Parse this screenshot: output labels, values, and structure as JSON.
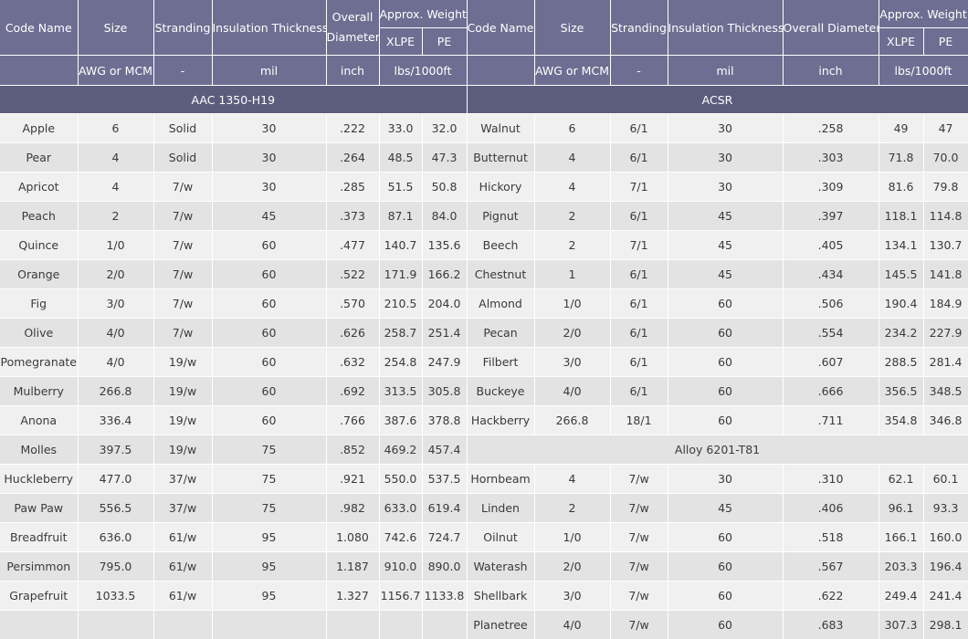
{
  "headers": {
    "code_name": "Code Name",
    "size": "Size",
    "stranding": "Stranding",
    "insulation_thickness": "Insulation Thickness",
    "overall_diameter_left": "Overall Diameter",
    "overall_diameter_right": "Overall Diameter",
    "approx_weight": "Approx. Weight",
    "xlpe": "XLPE",
    "pe": "PE"
  },
  "units": {
    "size": "AWG or MCM",
    "stranding": "-",
    "insulation": "mil",
    "diameter": "inch",
    "weight": "lbs/1000ft"
  },
  "sections": {
    "left_title": "AAC 1350-H19",
    "right_title": "ACSR",
    "right_subsection": "Alloy 6201-T81"
  },
  "left_rows": [
    {
      "code": "Apple",
      "size": "6",
      "strand": "Solid",
      "ins": "30",
      "dia": ".222",
      "xlpe": "33.0",
      "pe": "32.0"
    },
    {
      "code": "Pear",
      "size": "4",
      "strand": "Solid",
      "ins": "30",
      "dia": ".264",
      "xlpe": "48.5",
      "pe": "47.3"
    },
    {
      "code": "Apricot",
      "size": "4",
      "strand": "7/w",
      "ins": "30",
      "dia": ".285",
      "xlpe": "51.5",
      "pe": "50.8"
    },
    {
      "code": "Peach",
      "size": "2",
      "strand": "7/w",
      "ins": "45",
      "dia": ".373",
      "xlpe": "87.1",
      "pe": "84.0"
    },
    {
      "code": "Quince",
      "size": "1/0",
      "strand": "7/w",
      "ins": "60",
      "dia": ".477",
      "xlpe": "140.7",
      "pe": "135.6"
    },
    {
      "code": "Orange",
      "size": "2/0",
      "strand": "7/w",
      "ins": "60",
      "dia": ".522",
      "xlpe": "171.9",
      "pe": "166.2"
    },
    {
      "code": "Fig",
      "size": "3/0",
      "strand": "7/w",
      "ins": "60",
      "dia": ".570",
      "xlpe": "210.5",
      "pe": "204.0"
    },
    {
      "code": "Olive",
      "size": "4/0",
      "strand": "7/w",
      "ins": "60",
      "dia": ".626",
      "xlpe": "258.7",
      "pe": "251.4"
    },
    {
      "code": "Pomegranate",
      "size": "4/0",
      "strand": "19/w",
      "ins": "60",
      "dia": ".632",
      "xlpe": "254.8",
      "pe": "247.9"
    },
    {
      "code": "Mulberry",
      "size": "266.8",
      "strand": "19/w",
      "ins": "60",
      "dia": ".692",
      "xlpe": "313.5",
      "pe": "305.8"
    },
    {
      "code": "Anona",
      "size": "336.4",
      "strand": "19/w",
      "ins": "60",
      "dia": ".766",
      "xlpe": "387.6",
      "pe": "378.8"
    },
    {
      "code": "Molles",
      "size": "397.5",
      "strand": "19/w",
      "ins": "75",
      "dia": ".852",
      "xlpe": "469.2",
      "pe": "457.4"
    },
    {
      "code": "Huckleberry",
      "size": "477.0",
      "strand": "37/w",
      "ins": "75",
      "dia": ".921",
      "xlpe": "550.0",
      "pe": "537.5"
    },
    {
      "code": "Paw Paw",
      "size": "556.5",
      "strand": "37/w",
      "ins": "75",
      "dia": ".982",
      "xlpe": "633.0",
      "pe": "619.4"
    },
    {
      "code": "Breadfruit",
      "size": "636.0",
      "strand": "61/w",
      "ins": "95",
      "dia": "1.080",
      "xlpe": "742.6",
      "pe": "724.7"
    },
    {
      "code": "Persimmon",
      "size": "795.0",
      "strand": "61/w",
      "ins": "95",
      "dia": "1.187",
      "xlpe": "910.0",
      "pe": "890.0"
    },
    {
      "code": "Grapefruit",
      "size": "1033.5",
      "strand": "61/w",
      "ins": "95",
      "dia": "1.327",
      "xlpe": "1156.7",
      "pe": "1133.8"
    }
  ],
  "right_rows": [
    {
      "code": "Walnut",
      "size": "6",
      "strand": "6/1",
      "ins": "30",
      "dia": ".258",
      "xlpe": "49",
      "pe": "47"
    },
    {
      "code": "Butternut",
      "size": "4",
      "strand": "6/1",
      "ins": "30",
      "dia": ".303",
      "xlpe": "71.8",
      "pe": "70.0"
    },
    {
      "code": "Hickory",
      "size": "4",
      "strand": "7/1",
      "ins": "30",
      "dia": ".309",
      "xlpe": "81.6",
      "pe": "79.8"
    },
    {
      "code": "Pignut",
      "size": "2",
      "strand": "6/1",
      "ins": "45",
      "dia": ".397",
      "xlpe": "118.1",
      "pe": "114.8"
    },
    {
      "code": "Beech",
      "size": "2",
      "strand": "7/1",
      "ins": "45",
      "dia": ".405",
      "xlpe": "134.1",
      "pe": "130.7"
    },
    {
      "code": "Chestnut",
      "size": "1",
      "strand": "6/1",
      "ins": "45",
      "dia": ".434",
      "xlpe": "145.5",
      "pe": "141.8"
    },
    {
      "code": "Almond",
      "size": "1/0",
      "strand": "6/1",
      "ins": "60",
      "dia": ".506",
      "xlpe": "190.4",
      "pe": "184.9"
    },
    {
      "code": "Pecan",
      "size": "2/0",
      "strand": "6/1",
      "ins": "60",
      "dia": ".554",
      "xlpe": "234.2",
      "pe": "227.9"
    },
    {
      "code": "Filbert",
      "size": "3/0",
      "strand": "6/1",
      "ins": "60",
      "dia": ".607",
      "xlpe": "288.5",
      "pe": "281.4"
    },
    {
      "code": "Buckeye",
      "size": "4/0",
      "strand": "6/1",
      "ins": "60",
      "dia": ".666",
      "xlpe": "356.5",
      "pe": "348.5"
    },
    {
      "code": "Hackberry",
      "size": "266.8",
      "strand": "18/1",
      "ins": "60",
      "dia": ".711",
      "xlpe": "354.8",
      "pe": "346.8"
    },
    {
      "subsection": true
    },
    {
      "code": "Hornbeam",
      "size": "4",
      "strand": "7/w",
      "ins": "30",
      "dia": ".310",
      "xlpe": "62.1",
      "pe": "60.1"
    },
    {
      "code": "Linden",
      "size": "2",
      "strand": "7/w",
      "ins": "45",
      "dia": ".406",
      "xlpe": "96.1",
      "pe": "93.3"
    },
    {
      "code": "Oilnut",
      "size": "1/0",
      "strand": "7/w",
      "ins": "60",
      "dia": ".518",
      "xlpe": "166.1",
      "pe": "160.0"
    },
    {
      "code": "Waterash",
      "size": "2/0",
      "strand": "7/w",
      "ins": "60",
      "dia": ".567",
      "xlpe": "203.3",
      "pe": "196.4"
    },
    {
      "code": "Shellbark",
      "size": "3/0",
      "strand": "7/w",
      "ins": "60",
      "dia": ".622",
      "xlpe": "249.4",
      "pe": "241.4"
    },
    {
      "code": "Planetree",
      "size": "4/0",
      "strand": "7/w",
      "ins": "60",
      "dia": ".683",
      "xlpe": "307.3",
      "pe": "298.1"
    }
  ]
}
